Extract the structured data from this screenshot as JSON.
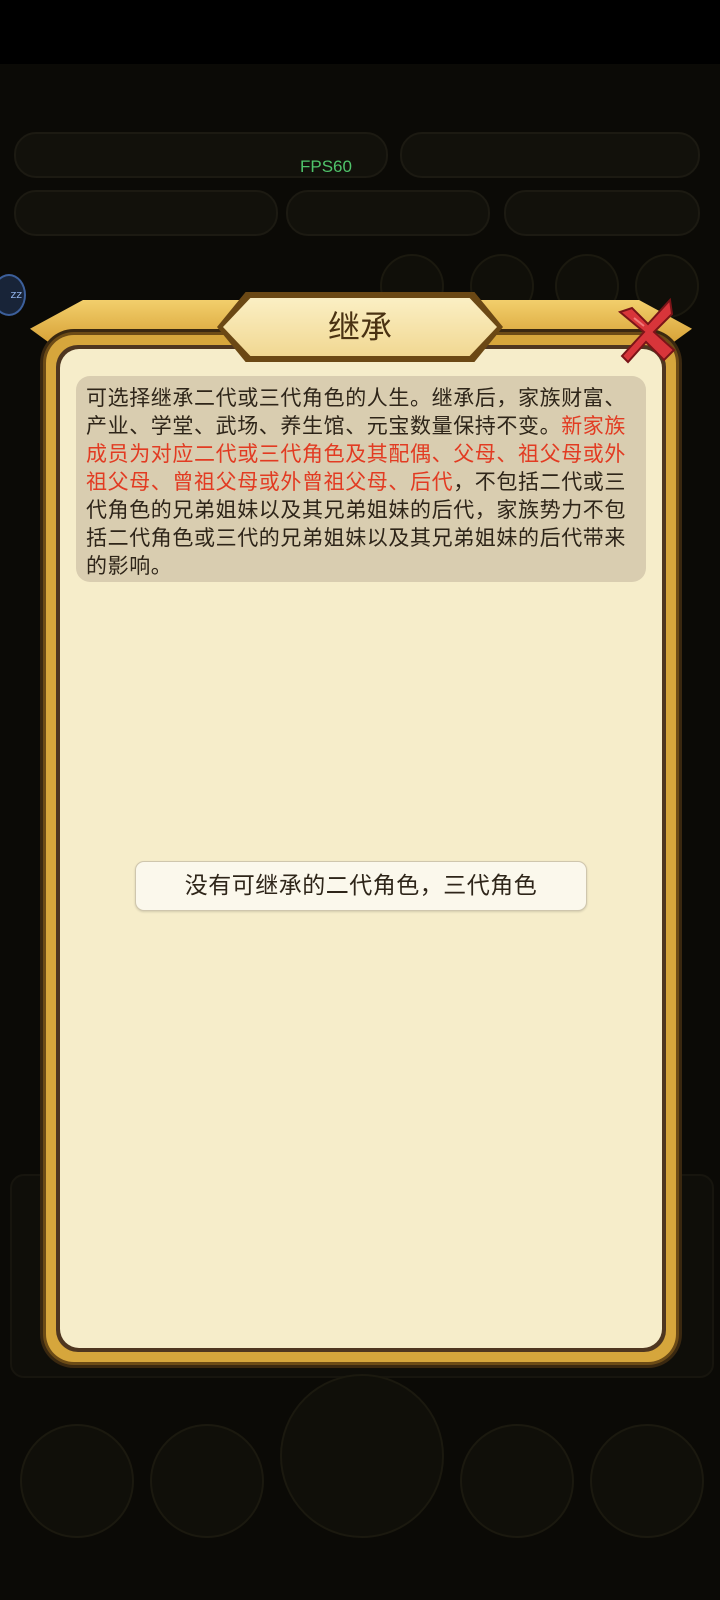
{
  "status": {
    "fps": "FPS60",
    "badge": "zz"
  },
  "dialog": {
    "title": "继承",
    "close_icon": "close-cross-icon",
    "description_normal_1": "可选择继承二代或三代角色的人生。继承后，家族财富、产业、学堂、武场、养生馆、元宝数量保持不变。",
    "description_highlight": "新家族成员为对应二代或三代角色及其配偶、父母、祖父母或外祖父母、曾祖父母或外曾祖父母、后代",
    "description_normal_2": "，不包括二代或三代角色的兄弟姐妹以及其兄弟姐妹的后代，家族势力不包括二代角色或三代的兄弟姐妹以及其兄弟姐妹的后代带来的影响。",
    "empty_message": "没有可继承的二代角色，三代角色"
  },
  "colors": {
    "highlight_text": "#e23b22",
    "paper": "#f6edca",
    "frame_gold": "#d6a63c",
    "fps_green": "#4fc36a"
  }
}
